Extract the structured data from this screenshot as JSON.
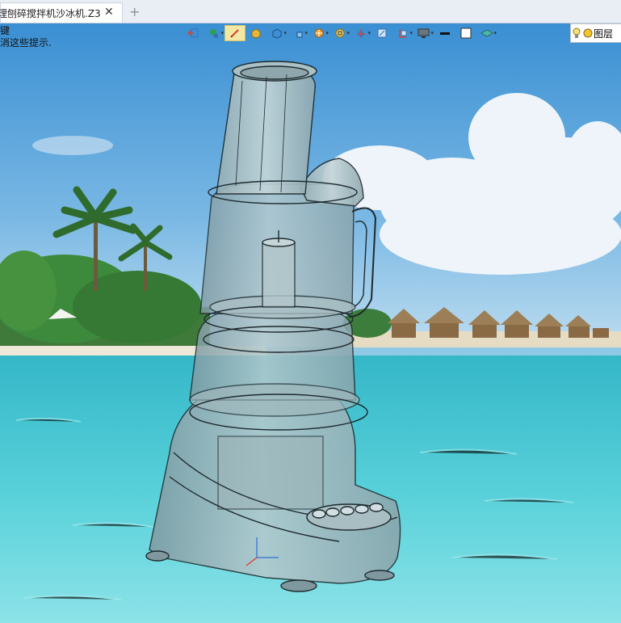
{
  "tab": {
    "title": "理刨碎搅拌机沙冰机.Z3",
    "close_glyph": "✕",
    "add_glyph": "+"
  },
  "hint": {
    "line1": "键",
    "line2": "消这些提示."
  },
  "toolbar": {
    "icons": [
      "exit-icon",
      "render-mode-icon",
      "sketch-pen-icon",
      "shaded-box-icon",
      "shaded-cube-icon",
      "view-cube-icon",
      "section-color-icon",
      "zoom-fit-icon",
      "axis-tripod-icon",
      "frame-view-icon",
      "section-plane-icon",
      "monitor-display-icon",
      "line-color-icon",
      "background-color-icon",
      "layer-stack-icon"
    ]
  },
  "layer": {
    "label": "图层",
    "icons": [
      "lightbulb-icon",
      "layer-color-icon"
    ]
  }
}
